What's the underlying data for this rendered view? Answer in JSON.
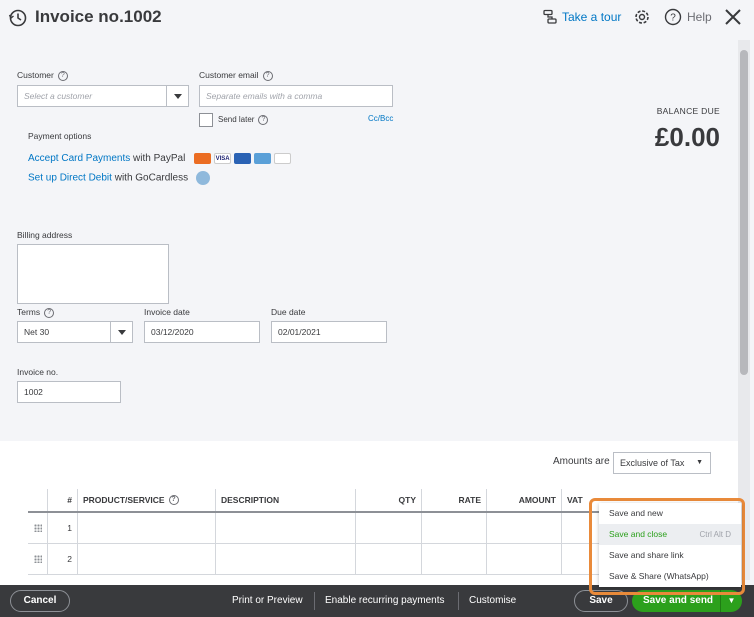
{
  "header": {
    "title": "Invoice no.1002",
    "tour_label": "Take a tour",
    "help_label": "Help"
  },
  "customer": {
    "label": "Customer",
    "placeholder": "Select a customer"
  },
  "email": {
    "label": "Customer email",
    "placeholder": "Separate emails with a comma",
    "send_later": "Send later",
    "cc_bcc": "Cc/Bcc"
  },
  "payment": {
    "title": "Payment options",
    "card_link": "Accept Card Payments",
    "card_suffix": " with PayPal",
    "debit_link": "Set up Direct Debit",
    "debit_suffix": " with GoCardless"
  },
  "balance": {
    "label": "BALANCE DUE",
    "value": "£0.00"
  },
  "billing": {
    "label": "Billing address"
  },
  "terms": {
    "label": "Terms",
    "value": "Net 30"
  },
  "invoice_date": {
    "label": "Invoice date",
    "value": "03/12/2020"
  },
  "due_date": {
    "label": "Due date",
    "value": "02/01/2021"
  },
  "invoice_no": {
    "label": "Invoice no.",
    "value": "1002"
  },
  "amounts": {
    "label": "Amounts are",
    "value": "Exclusive of Tax"
  },
  "table": {
    "headers": [
      "#",
      "PRODUCT/SERVICE",
      "DESCRIPTION",
      "QTY",
      "RATE",
      "AMOUNT",
      "VAT"
    ],
    "rows": [
      {
        "num": "1"
      },
      {
        "num": "2"
      }
    ]
  },
  "footer": {
    "cancel": "Cancel",
    "print": "Print or Preview",
    "recurring": "Enable recurring payments",
    "customise": "Customise",
    "save": "Save",
    "save_send": "Save and send"
  },
  "save_menu": {
    "items": [
      {
        "label": "Save and new",
        "shortcut": ""
      },
      {
        "label": "Save and close",
        "shortcut": "Ctrl Alt D"
      },
      {
        "label": "Save and share link",
        "shortcut": ""
      },
      {
        "label": "Save & Share (WhatsApp)",
        "shortcut": ""
      }
    ]
  },
  "colors": {
    "accent_green": "#2ca01c",
    "link_blue": "#0077c5",
    "footer_bg": "#393a3d",
    "highlight_orange": "#e98a3a"
  }
}
